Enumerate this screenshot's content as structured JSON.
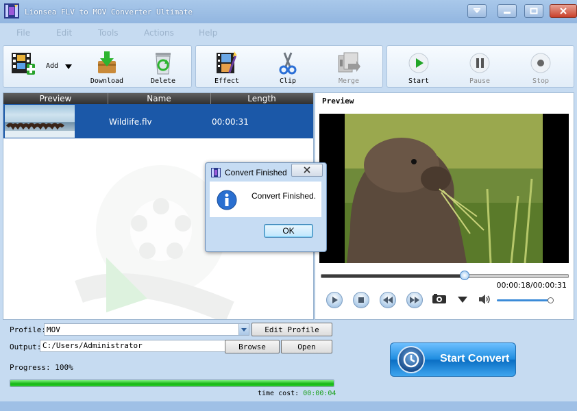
{
  "window": {
    "title": "Lionsea FLV to MOV Converter Ultimate"
  },
  "menu": [
    "File",
    "Edit",
    "Tools",
    "Actions",
    "Help"
  ],
  "toolbar": {
    "add": "Add",
    "download": "Download",
    "delete": "Delete",
    "effect": "Effect",
    "clip": "Clip",
    "merge": "Merge",
    "start": "Start",
    "pause": "Pause",
    "stop": "Stop"
  },
  "file_list": {
    "columns": [
      "Preview",
      "Name",
      "Length"
    ],
    "rows": [
      {
        "name": "Wildlife.flv",
        "length": "00:00:31"
      }
    ]
  },
  "preview": {
    "title": "Preview",
    "time": "00:00:18/00:00:31",
    "seek_fraction": 0.58,
    "volume_fraction": 0.95
  },
  "settings": {
    "profile_label": "Profile:",
    "profile_value": "MOV",
    "edit_profile": "Edit Profile",
    "output_label": "Output:",
    "output_value": "C:/Users/Administrator",
    "browse": "Browse",
    "open": "Open",
    "progress_label": "Progress: 100%",
    "progress_fraction": 1.0,
    "time_cost_label": "time cost:",
    "time_cost_value": "00:00:04",
    "start_convert": "Start Convert"
  },
  "dialog": {
    "title": "Convert Finished",
    "message": "Convert Finished.",
    "ok": "OK"
  },
  "colors": {
    "selection": "#1b58a8",
    "progress": "#12b512",
    "time_cost": "#1aa01a",
    "accent": "#1f8de0"
  }
}
